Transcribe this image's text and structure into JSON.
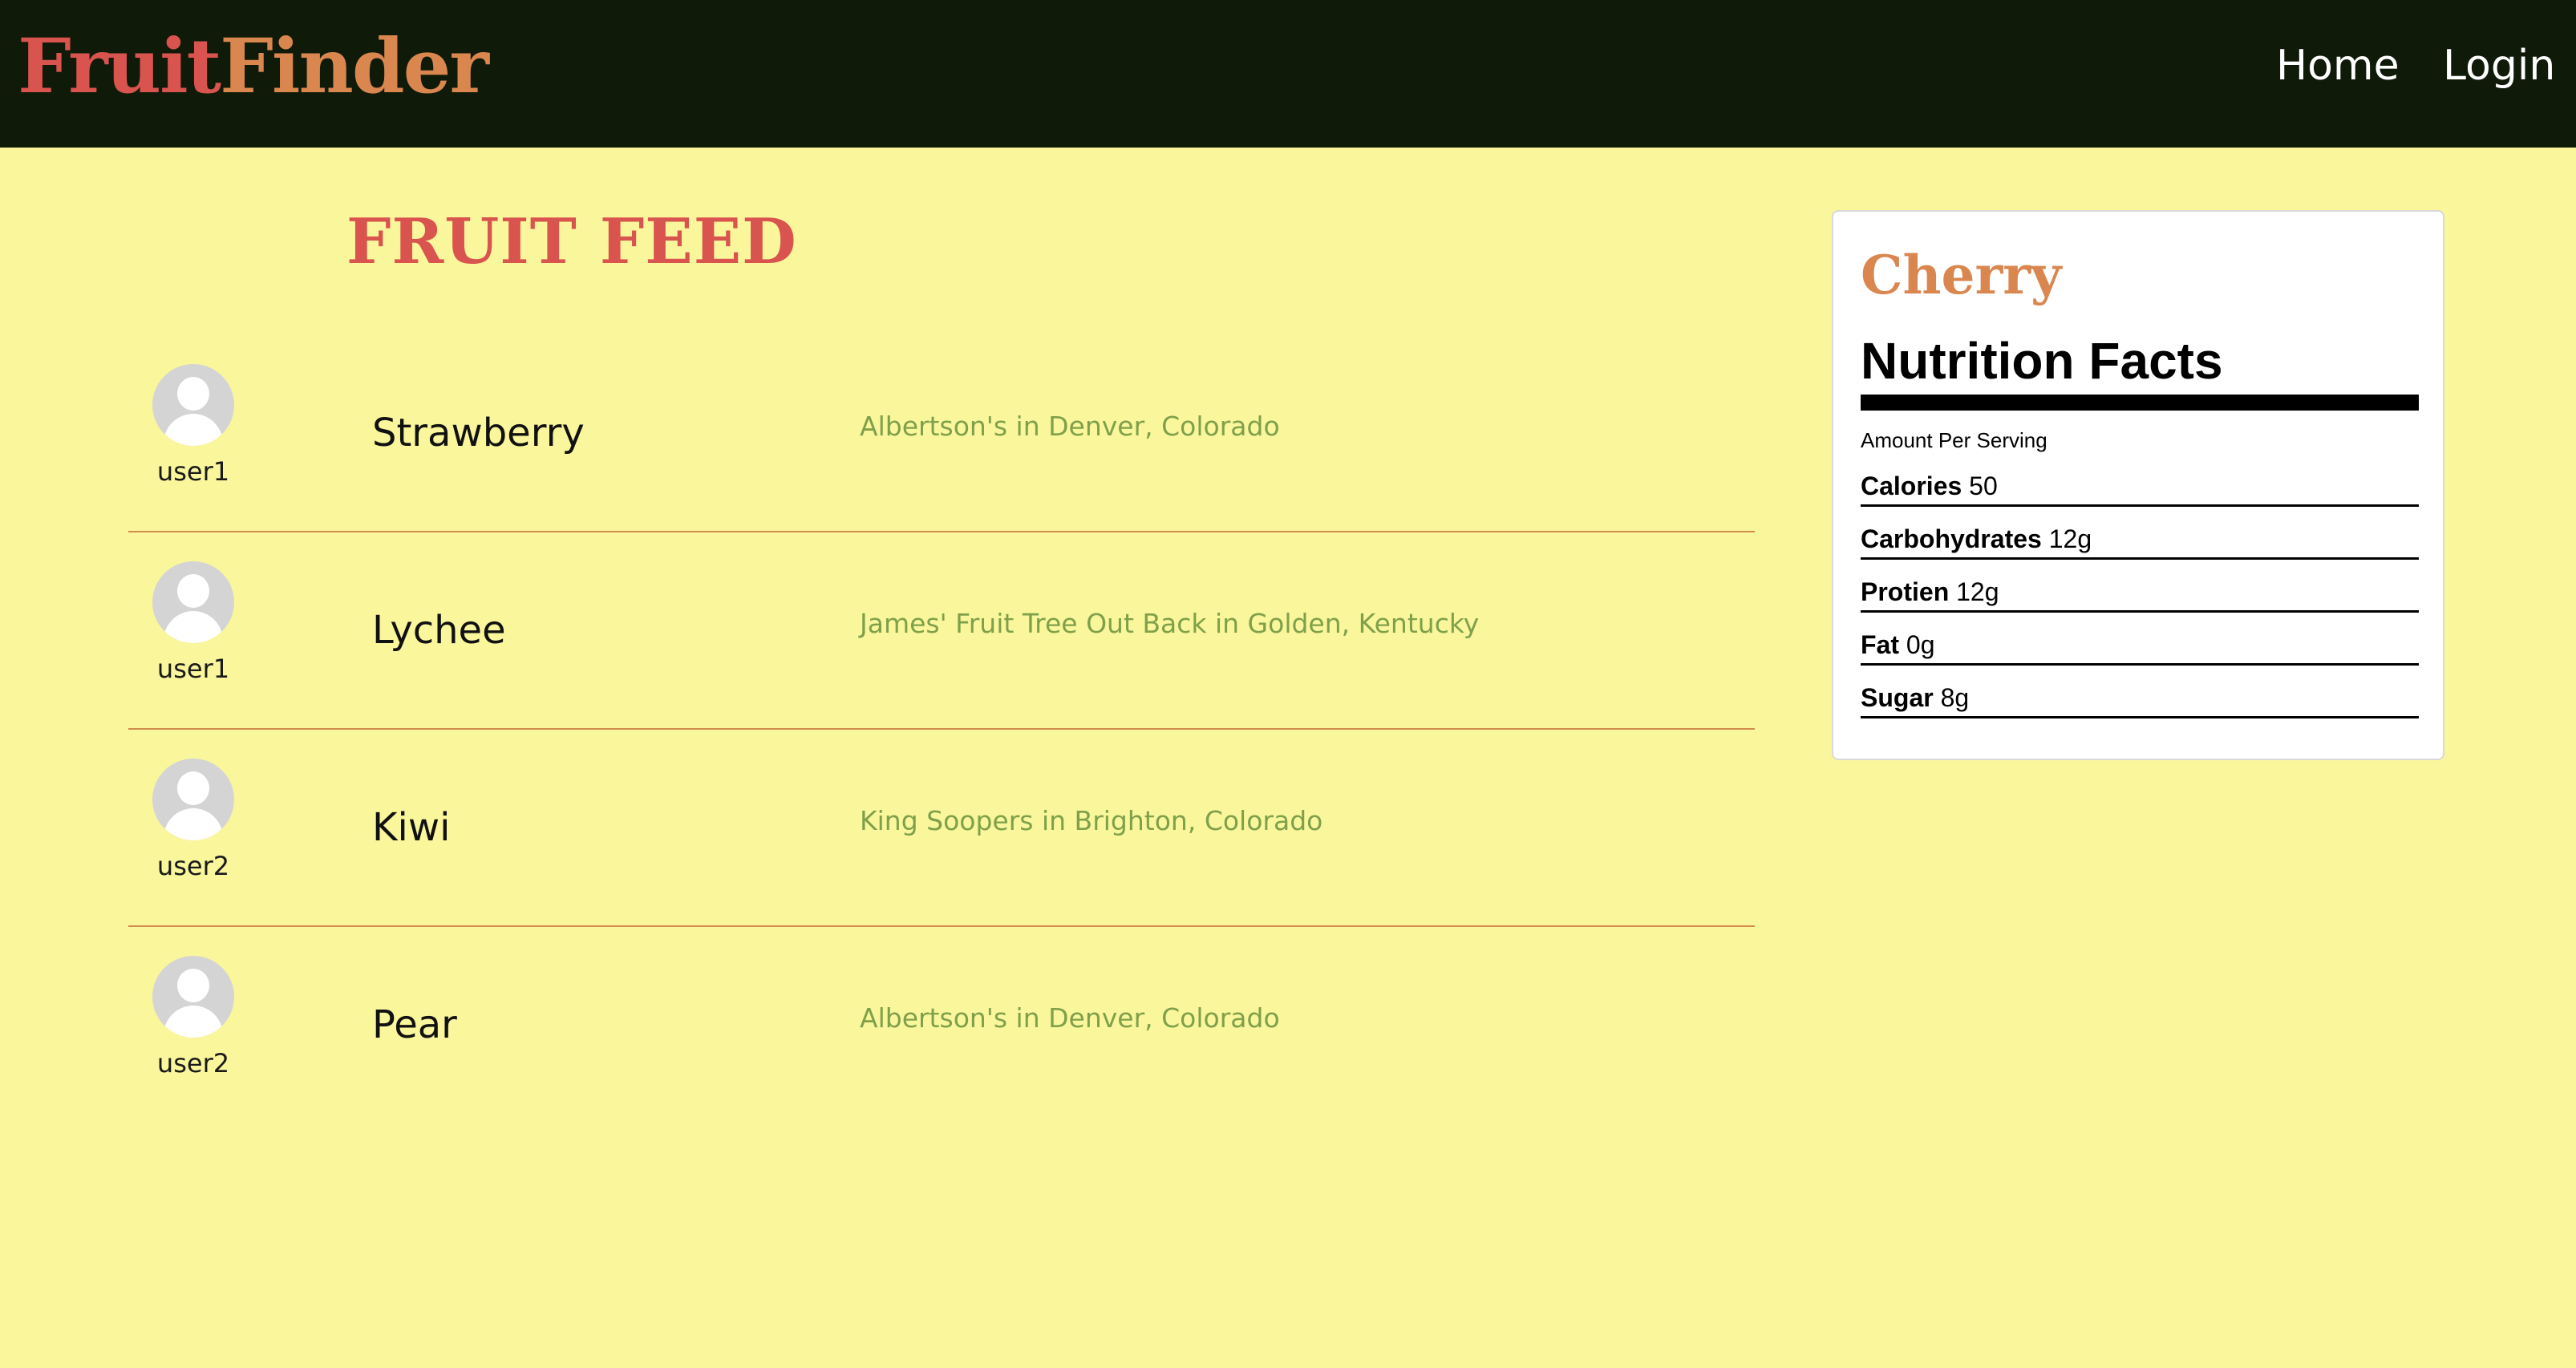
{
  "brand": {
    "part1": "Fruit",
    "part2": "Finder"
  },
  "nav": {
    "home": "Home",
    "login": "Login"
  },
  "feed": {
    "title": "FRUIT FEED",
    "posts": [
      {
        "user": "user1",
        "fruit": "Strawberry",
        "location": "Albertson's in Denver, Colorado"
      },
      {
        "user": "user1",
        "fruit": "Lychee",
        "location": "James' Fruit Tree Out Back in Golden, Kentucky"
      },
      {
        "user": "user2",
        "fruit": "Kiwi",
        "location": "King Soopers in Brighton, Colorado"
      },
      {
        "user": "user2",
        "fruit": "Pear",
        "location": "Albertson's in Denver, Colorado"
      }
    ]
  },
  "nutrition": {
    "fruit": "Cherry",
    "heading": "Nutrition Facts",
    "amount_per_serving": "Amount Per Serving",
    "rows": [
      {
        "label": "Calories",
        "value": "50"
      },
      {
        "label": "Carbohydrates",
        "value": "12g"
      },
      {
        "label": "Protien",
        "value": "12g"
      },
      {
        "label": "Fat",
        "value": "0g"
      },
      {
        "label": "Sugar",
        "value": "8g"
      }
    ]
  },
  "colors": {
    "navbar_bg": "#0f1a08",
    "page_bg": "#faf69c",
    "brand_red": "#d9534f",
    "brand_orange": "#d9864f",
    "location_green": "#7fa04a",
    "divider": "#d28c4e"
  },
  "icons": {
    "avatar": "user-avatar-icon"
  }
}
